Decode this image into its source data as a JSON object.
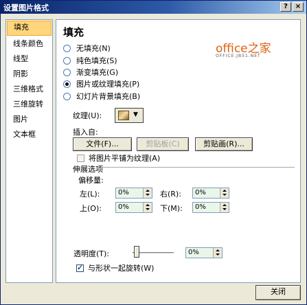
{
  "window": {
    "title": "设置图片格式",
    "help_label": "?",
    "close_label": "×"
  },
  "nav": {
    "items": [
      {
        "label": "填充"
      },
      {
        "label": "线条颜色"
      },
      {
        "label": "线型"
      },
      {
        "label": "阴影"
      },
      {
        "label": "三维格式"
      },
      {
        "label": "三维旋转"
      },
      {
        "label": "图片"
      },
      {
        "label": "文本框"
      }
    ],
    "active_index": 0
  },
  "panel": {
    "heading": "填充",
    "fill_options": [
      {
        "label": "无填充(N)",
        "selected": false
      },
      {
        "label": "纯色填充(S)",
        "selected": false
      },
      {
        "label": "渐变填充(G)",
        "selected": false
      },
      {
        "label": "图片或纹理填充(P)",
        "selected": true
      },
      {
        "label": "幻灯片背景填充(B)",
        "selected": false
      }
    ],
    "texture_label": "纹理(U):",
    "insert_from_label": "插入自:",
    "file_button": "文件(F)...",
    "clipboard_button": "剪贴板(C)",
    "clipart_button": "剪贴画(R)...",
    "tile_checkbox_label": "将图片平铺为纹理(A)",
    "tile_checked": false,
    "stretch_section_label": "伸展选项",
    "offset_label": "偏移量:",
    "offsets": {
      "left_label": "左(L):",
      "left_value": "0%",
      "right_label": "右(R):",
      "right_value": "0%",
      "top_label": "上(O):",
      "top_value": "0%",
      "bottom_label": "下(M):",
      "bottom_value": "0%"
    },
    "transparency_label": "透明度(T):",
    "transparency_value": "0%",
    "rotate_label": "与形状一起旋转(W)",
    "rotate_checked": true
  },
  "watermark": {
    "main": "office之家",
    "sub": "OFFICE.JB51.NET"
  },
  "footer": {
    "close_button": "关闭"
  },
  "colors": {
    "title_bar": "#0a246a",
    "dialog_bg": "#ece9d8",
    "active_nav": "#ffd67b",
    "spin_bg": "#eaf6ea",
    "watermark": "#e06010"
  }
}
